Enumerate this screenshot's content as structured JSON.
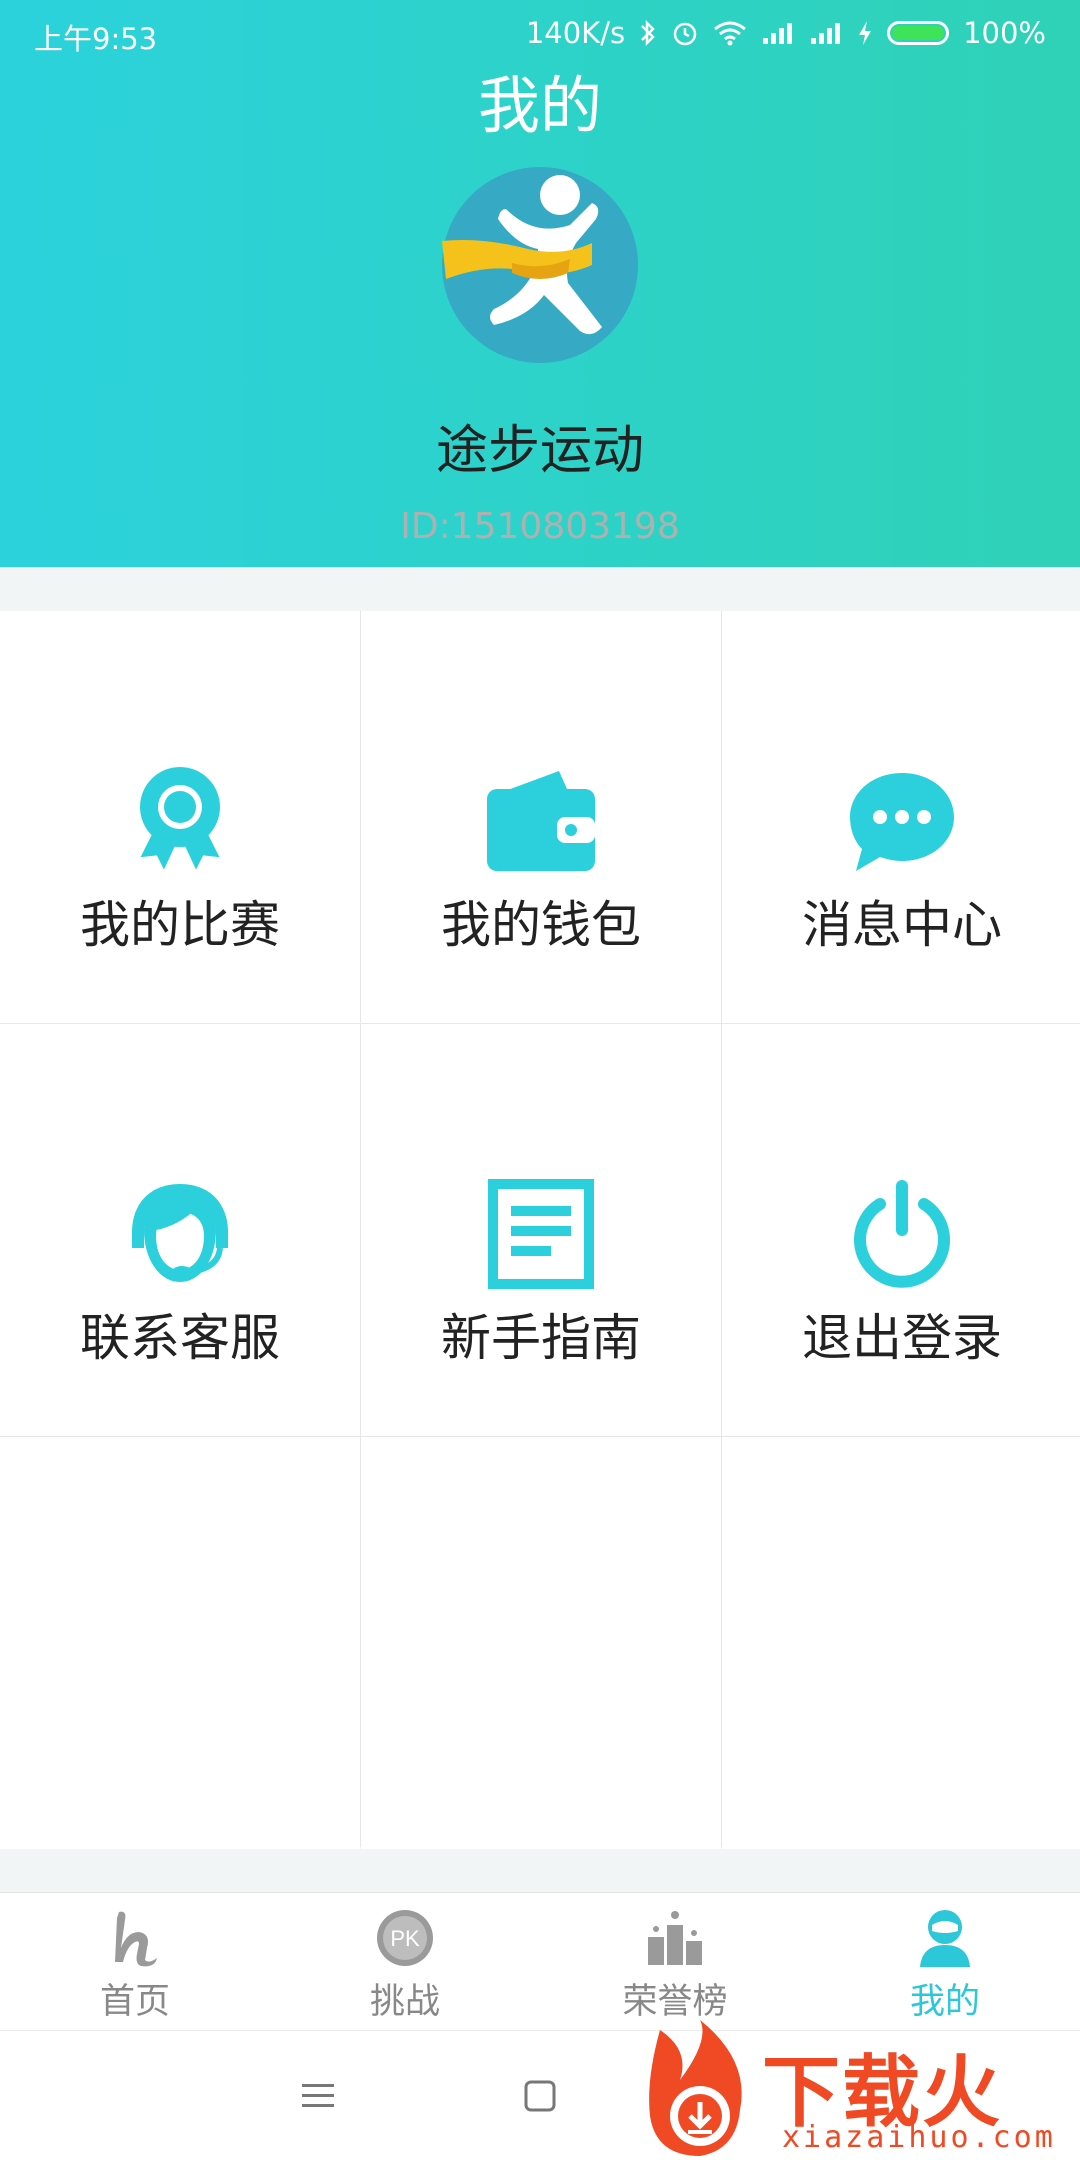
{
  "status_bar": {
    "time": "上午9:53",
    "speed": "140K/s",
    "battery": "100%"
  },
  "header": {
    "title": "我的",
    "username": "途步运动",
    "user_id": "ID:1510803198"
  },
  "menu": [
    {
      "label": "我的比赛",
      "icon": "award-icon"
    },
    {
      "label": "我的钱包",
      "icon": "wallet-icon"
    },
    {
      "label": "消息中心",
      "icon": "chat-icon"
    },
    {
      "label": "联系客服",
      "icon": "headset-icon"
    },
    {
      "label": "新手指南",
      "icon": "guide-icon"
    },
    {
      "label": "退出登录",
      "icon": "power-icon"
    }
  ],
  "tabs": [
    {
      "label": "首页",
      "icon": "home-icon",
      "active": false
    },
    {
      "label": "挑战",
      "icon": "pk-icon",
      "active": false
    },
    {
      "label": "荣誉榜",
      "icon": "podium-icon",
      "active": false
    },
    {
      "label": "我的",
      "icon": "profile-icon",
      "active": true
    }
  ],
  "watermark": {
    "title": "下载火",
    "url": "xiazaihuo.com"
  },
  "colors": {
    "accent": "#2cc7d9",
    "header_start": "#2bd2dc",
    "header_end": "#2fd2b6"
  }
}
